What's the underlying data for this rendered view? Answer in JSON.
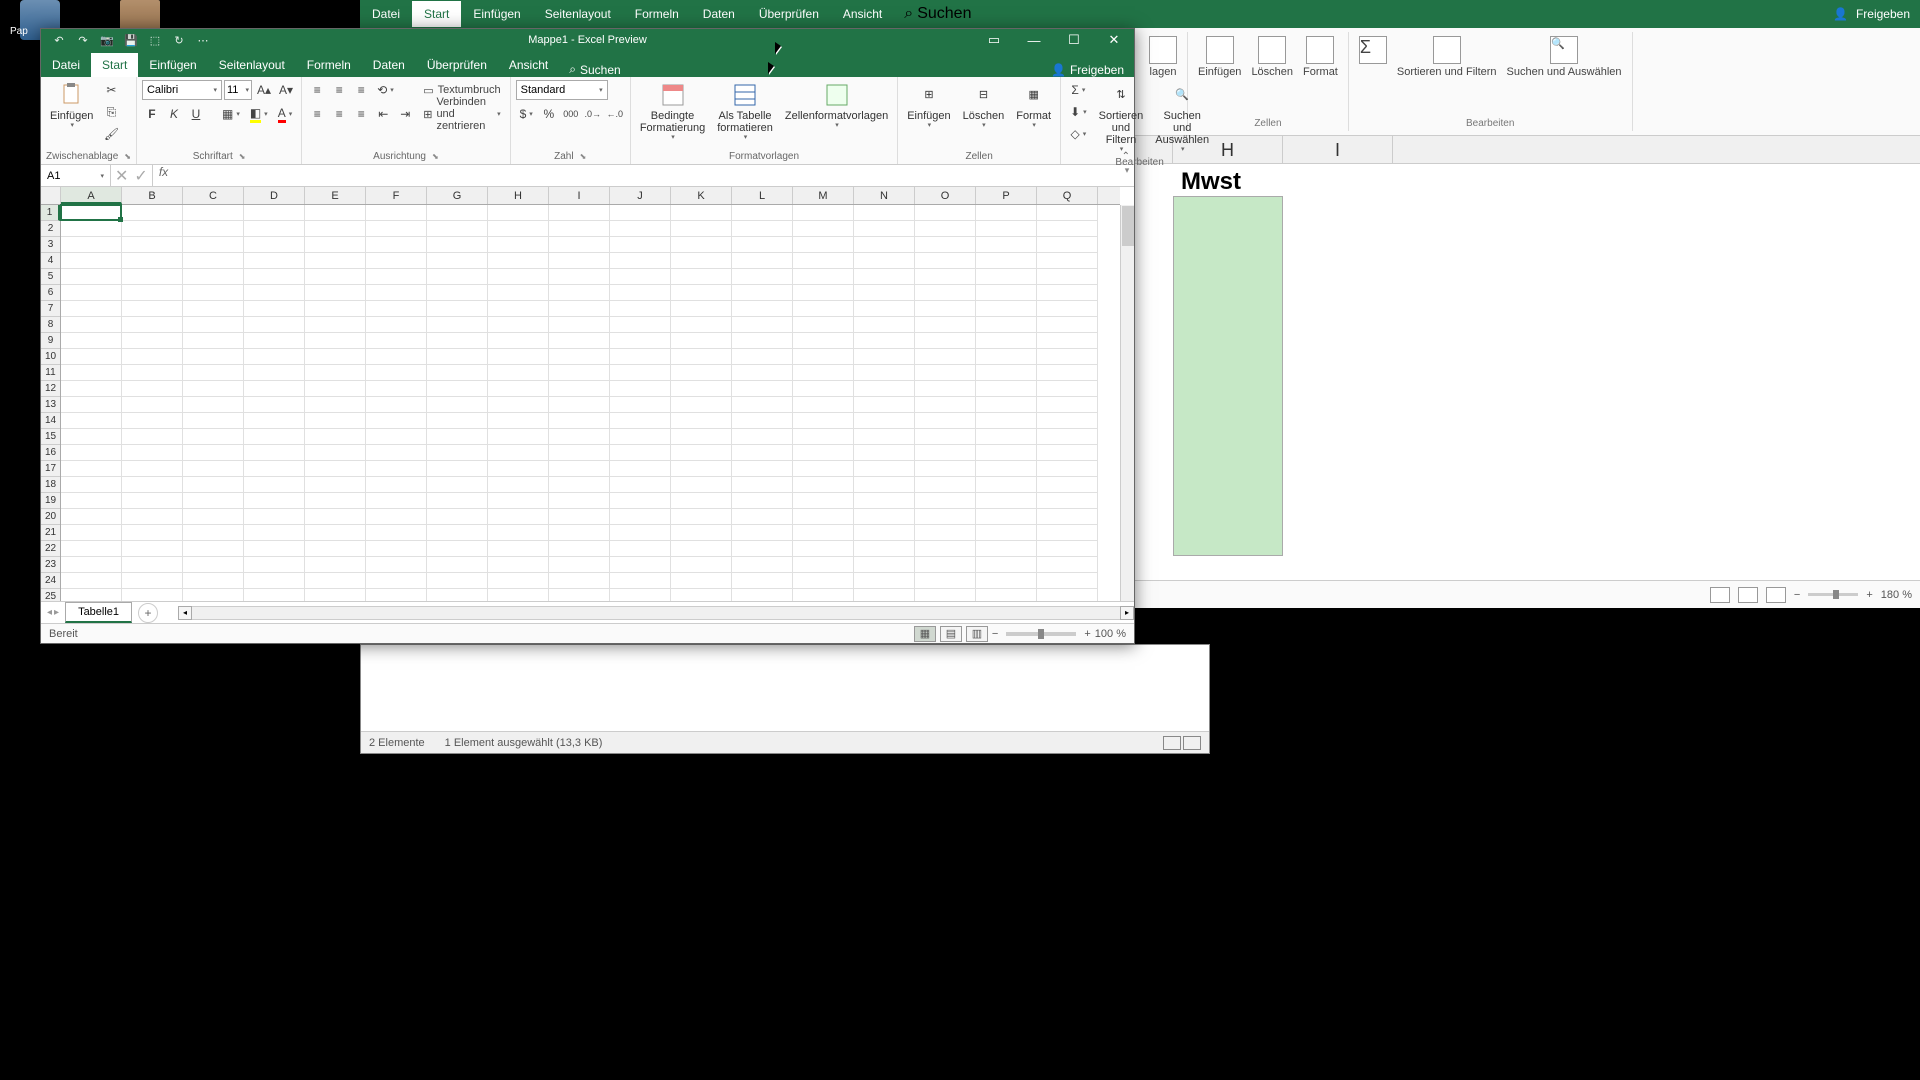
{
  "desktop": {
    "label_left": "Pap"
  },
  "bg_window": {
    "tabs": [
      "Datei",
      "Start",
      "Einfügen",
      "Seitenlayout",
      "Formeln",
      "Daten",
      "Überprüfen",
      "Ansicht"
    ],
    "active_tab_index": 1,
    "search": "Suchen",
    "share": "Freigeben",
    "ribbon": {
      "insert": "Einfügen",
      "delete": "Löschen",
      "format": "Format",
      "cells_group": "Zellen",
      "sort_filter": "Sortieren und Filtern",
      "find_select": "Suchen und Auswählen",
      "edit_group": "Bearbeiten",
      "styles_suffix": "lagen"
    },
    "columns": [
      "H",
      "I"
    ],
    "cell_h1": "Mwst",
    "zoom": "180 %"
  },
  "explorer": {
    "items": "2 Elemente",
    "selected": "1 Element ausgewählt (13,3 KB)"
  },
  "excel": {
    "title": "Mappe1 - Excel Preview",
    "menu": {
      "tabs": [
        "Datei",
        "Start",
        "Einfügen",
        "Seitenlayout",
        "Formeln",
        "Daten",
        "Überprüfen",
        "Ansicht"
      ],
      "active_tab_index": 1,
      "search": "Suchen",
      "share": "Freigeben"
    },
    "ribbon": {
      "clipboard": {
        "paste": "Einfügen",
        "group": "Zwischenablage"
      },
      "font": {
        "name": "Calibri",
        "size": "11",
        "group": "Schriftart"
      },
      "alignment": {
        "wrap": "Textumbruch",
        "merge": "Verbinden und zentrieren",
        "group": "Ausrichtung"
      },
      "number": {
        "format": "Standard",
        "group": "Zahl"
      },
      "styles": {
        "cond": "Bedingte Formatierung",
        "table": "Als Tabelle formatieren",
        "cell": "Zellenformatvorlagen",
        "group": "Formatvorlagen"
      },
      "cells": {
        "insert": "Einfügen",
        "delete": "Löschen",
        "format": "Format",
        "group": "Zellen"
      },
      "editing": {
        "sort": "Sortieren und Filtern",
        "find": "Suchen und Auswählen",
        "group": "Bearbeiten"
      }
    },
    "namebox": "A1",
    "columns": [
      "A",
      "B",
      "C",
      "D",
      "E",
      "F",
      "G",
      "H",
      "I",
      "J",
      "K",
      "L",
      "M",
      "N",
      "O",
      "P",
      "Q"
    ],
    "rows": [
      "1",
      "2",
      "3",
      "4",
      "5",
      "6",
      "7",
      "8",
      "9",
      "10",
      "11",
      "12",
      "13",
      "14",
      "15",
      "16",
      "17",
      "18",
      "19",
      "20",
      "21",
      "22",
      "23",
      "24",
      "25"
    ],
    "sheet_tab": "Tabelle1",
    "status": "Bereit",
    "zoom": "100 %"
  }
}
